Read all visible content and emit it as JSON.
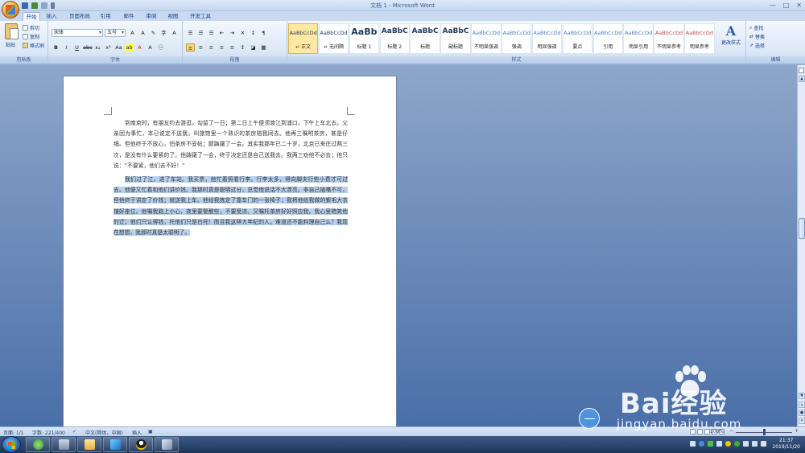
{
  "window": {
    "title": "文档 1 - Microsoft Word",
    "controls": [
      "—",
      "□",
      "✕"
    ]
  },
  "tabs": [
    "开始",
    "插入",
    "页面布局",
    "引用",
    "邮件",
    "审阅",
    "视图",
    "开发工具"
  ],
  "clipboard": {
    "paste": "粘贴",
    "cut": "剪切",
    "copy": "复制",
    "format_painter": "格式刷",
    "label": "剪贴板"
  },
  "font": {
    "family": "宋体",
    "size": "五号",
    "label": "字体"
  },
  "paragraph": {
    "label": "段落"
  },
  "styles": {
    "label": "样式",
    "items": [
      {
        "sample": "AaBbCcDd",
        "name": "↵ 正文",
        "size": "normal"
      },
      {
        "sample": "AaBbCcDd",
        "name": "↵ 无间隔",
        "size": "normal"
      },
      {
        "sample": "AaBb",
        "name": "标题 1",
        "size": "big"
      },
      {
        "sample": "AaBbC",
        "name": "标题 2",
        "size": "med"
      },
      {
        "sample": "AaBbC",
        "name": "标题",
        "size": "med"
      },
      {
        "sample": "AaBbC",
        "name": "副标题",
        "size": "med"
      },
      {
        "sample": "AaBbCcDd",
        "name": "不明显强调",
        "size": "normal"
      },
      {
        "sample": "AaBbCcDd",
        "name": "强调",
        "size": "normal"
      },
      {
        "sample": "AaBbCcDd",
        "name": "明显强调",
        "size": "normal"
      },
      {
        "sample": "AaBbCcDd",
        "name": "要点",
        "size": "normal"
      },
      {
        "sample": "AaBbCcDd",
        "name": "引用",
        "size": "normal"
      },
      {
        "sample": "AaBbCcDd",
        "name": "明显引用",
        "size": "normal"
      },
      {
        "sample": "AaBbCcDd",
        "name": "不明显参考",
        "size": "normal"
      },
      {
        "sample": "AaBbCcDd",
        "name": "明显参考",
        "size": "normal"
      }
    ],
    "change": "更改样式"
  },
  "editing": {
    "find": "查找",
    "replace": "替换",
    "select": "选择",
    "label": "编辑"
  },
  "document": {
    "para1": "到南京时，有朋友约去游逛，勾留了一日；第二日上午便须渡江到浦口，下午上车北去。父亲因为事忙，本已说定不送我，叫旅馆里一个熟识的茶房陪我同去。他再三嘱咐茶房，甚是仔细。但他终于不放心，怕茶房不妥帖；颇踌躇了一会。其实我那年已二十岁，北京已来往过两三次，是没有什么要紧的了。他踌躇了一会，终于决定还是自己送我去。我两三劝他不必去；他只说：“不要紧，他们去不好！”",
    "para2": "我们过了江，进了车站。我买票，他忙着照看行李。行李太多，得向脚夫行些小费才可过去。他便又忙着和他们讲价钱。我那时真是聪明过分，总觉他说话不大漂亮，非自己插嘴不可，但他终于讲定了价钱；就送我上车。他给我拣定了靠车门的一张椅子；我将他给我做的紫毛大衣铺好座位。他嘱我路上小心，夜里要警醒些，不要受凉。又嘱托茶房好好照应我。我心里暗笑他的迂；他们只认得钱，托他们只是白托！而且我这样大年纪的人，难道还不能料理自己么？我现在想想，我那时真是太聪明了。"
  },
  "status": {
    "page": "页面: 1/1",
    "words": "字数: 221/400",
    "lang": "中文(简体，中国)",
    "mode": "插入",
    "zoom": "100%"
  },
  "taskbar": {
    "time": "21:37",
    "date": "2019/11/20"
  },
  "watermark": {
    "text": "Bai经验",
    "url": "jingyan.baidu.com"
  }
}
